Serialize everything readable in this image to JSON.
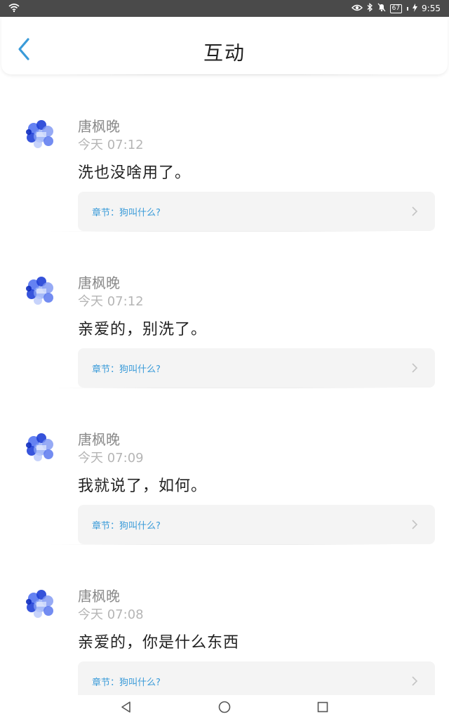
{
  "status_bar": {
    "battery": "67",
    "time": "9:55"
  },
  "header": {
    "title": "互动"
  },
  "colors": {
    "accent": "#3a9bd9",
    "status_bar_bg": "#4a4a4a"
  },
  "comments": [
    {
      "user": "唐枫晚",
      "time": "今天 07:12",
      "text": "洗也没啥用了。",
      "chapter": "章节：狗叫什么?"
    },
    {
      "user": "唐枫晚",
      "time": "今天 07:12",
      "text": "亲爱的，别洗了。",
      "chapter": "章节：狗叫什么?"
    },
    {
      "user": "唐枫晚",
      "time": "今天 07:09",
      "text": "我就说了，如何。",
      "chapter": "章节：狗叫什么?"
    },
    {
      "user": "唐枫晚",
      "time": "今天 07:08",
      "text": "亲爱的，你是什么东西",
      "chapter": "章节：狗叫什么?"
    }
  ],
  "icons": {
    "back": "chevron-left-icon",
    "chapter_arrow": "chevron-right-icon",
    "nav_back": "triangle-back-icon",
    "nav_home": "circle-home-icon",
    "nav_recents": "square-recents-icon"
  }
}
